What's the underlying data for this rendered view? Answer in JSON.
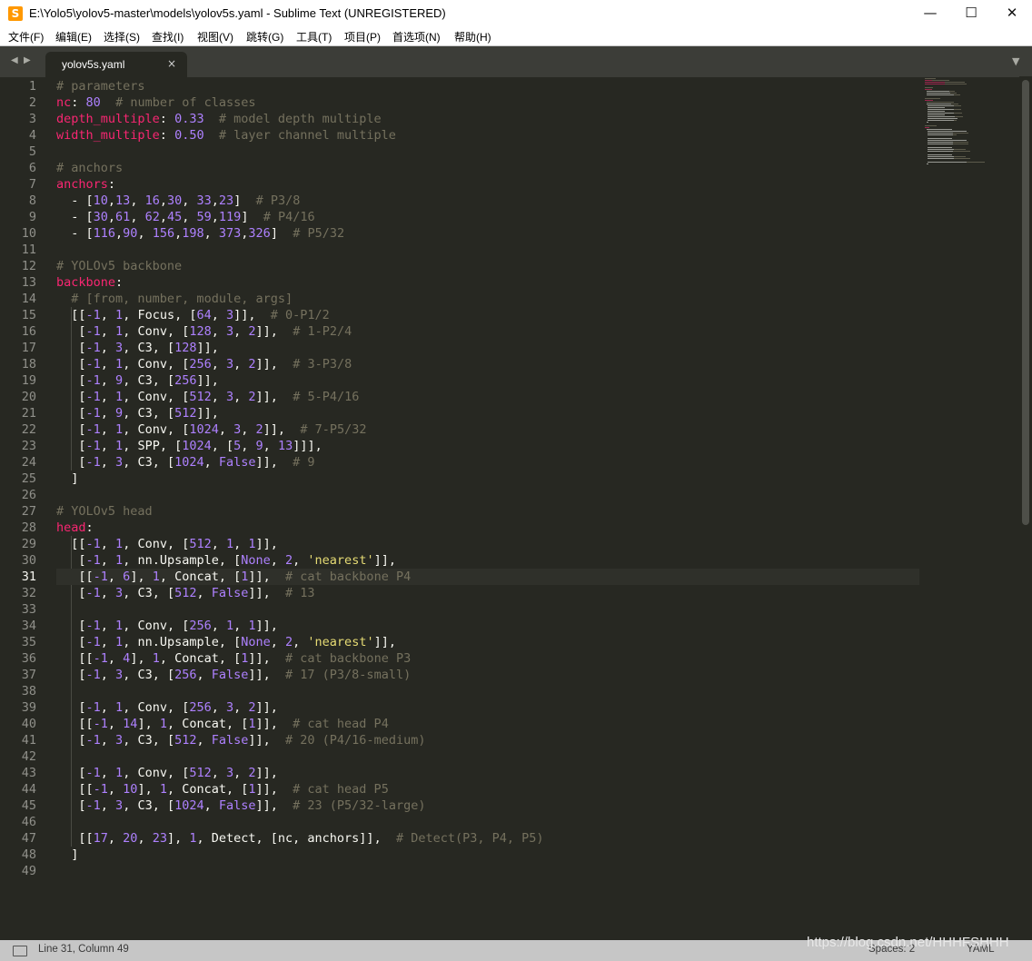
{
  "window": {
    "title": "E:\\Yolo5\\yolov5-master\\models\\yolov5s.yaml - Sublime Text (UNREGISTERED)",
    "app_icon_glyph": "S",
    "minimize_glyph": "—",
    "maximize_glyph": "☐",
    "close_glyph": "✕"
  },
  "menu": [
    "文件(F)",
    "编辑(E)",
    "选择(S)",
    "查找(I)",
    "视图(V)",
    "跳转(G)",
    "工具(T)",
    "项目(P)",
    "首选项(N)",
    "帮助(H)"
  ],
  "tabs": {
    "back_glyph": "◀",
    "forward_glyph": "▶",
    "active_label": "yolov5s.yaml",
    "close_glyph": "×",
    "dropdown_glyph": "▼"
  },
  "editor": {
    "current_line": 31,
    "colors": {
      "background": "#272822",
      "text": "#f8f8f2",
      "key": "#f92672",
      "number": "#ae81ff",
      "comment": "#75715e",
      "string": "#e6db74"
    },
    "lines": [
      "# parameters",
      "nc: 80  # number of classes",
      "depth_multiple: 0.33  # model depth multiple",
      "width_multiple: 0.50  # layer channel multiple",
      "",
      "# anchors",
      "anchors:",
      "  - [10,13, 16,30, 33,23]  # P3/8",
      "  - [30,61, 62,45, 59,119]  # P4/16",
      "  - [116,90, 156,198, 373,326]  # P5/32",
      "",
      "# YOLOv5 backbone",
      "backbone:",
      "  # [from, number, module, args]",
      "  [[-1, 1, Focus, [64, 3]],  # 0-P1/2",
      "   [-1, 1, Conv, [128, 3, 2]],  # 1-P2/4",
      "   [-1, 3, C3, [128]],",
      "   [-1, 1, Conv, [256, 3, 2]],  # 3-P3/8",
      "   [-1, 9, C3, [256]],",
      "   [-1, 1, Conv, [512, 3, 2]],  # 5-P4/16",
      "   [-1, 9, C3, [512]],",
      "   [-1, 1, Conv, [1024, 3, 2]],  # 7-P5/32",
      "   [-1, 1, SPP, [1024, [5, 9, 13]]],",
      "   [-1, 3, C3, [1024, False]],  # 9",
      "  ]",
      "",
      "# YOLOv5 head",
      "head:",
      "  [[-1, 1, Conv, [512, 1, 1]],",
      "   [-1, 1, nn.Upsample, [None, 2, 'nearest']],",
      "   [[-1, 6], 1, Concat, [1]],  # cat backbone P4",
      "   [-1, 3, C3, [512, False]],  # 13",
      "",
      "   [-1, 1, Conv, [256, 1, 1]],",
      "   [-1, 1, nn.Upsample, [None, 2, 'nearest']],",
      "   [[-1, 4], 1, Concat, [1]],  # cat backbone P3",
      "   [-1, 3, C3, [256, False]],  # 17 (P3/8-small)",
      "",
      "   [-1, 1, Conv, [256, 3, 2]],",
      "   [[-1, 14], 1, Concat, [1]],  # cat head P4",
      "   [-1, 3, C3, [512, False]],  # 20 (P4/16-medium)",
      "",
      "   [-1, 1, Conv, [512, 3, 2]],",
      "   [[-1, 10], 1, Concat, [1]],  # cat head P5",
      "   [-1, 3, C3, [1024, False]],  # 23 (P5/32-large)",
      "",
      "   [[17, 20, 23], 1, Detect, [nc, anchors]],  # Detect(P3, P4, P5)",
      "  ]",
      ""
    ]
  },
  "status": {
    "position": "Line 31, Column 49",
    "spaces": "Spaces: 2",
    "syntax": "YAML"
  },
  "watermark": "https://blog.csdn.net/HHHFSHHH"
}
